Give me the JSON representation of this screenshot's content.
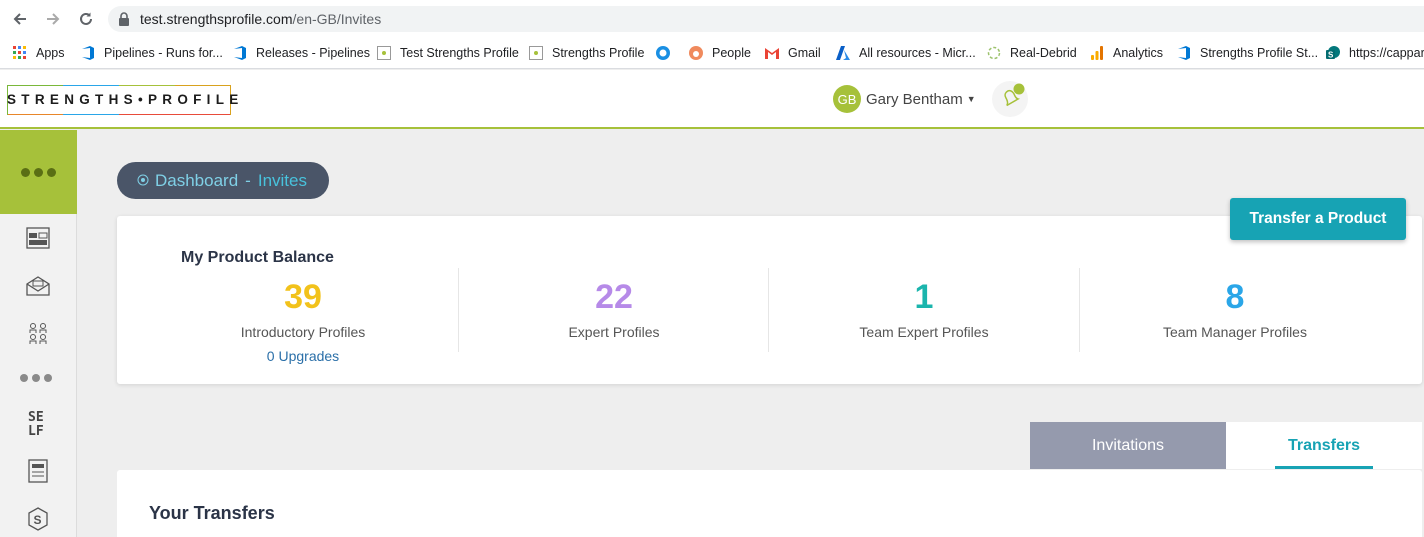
{
  "browser": {
    "url_host": "test.strengthsprofile.com",
    "url_path": "/en-GB/Invites",
    "bookmarks": [
      {
        "label": "Apps",
        "icon": "apps-grid-icon"
      },
      {
        "label": "Pipelines - Runs for...",
        "icon": "azure-devops-icon"
      },
      {
        "label": "Releases - Pipelines",
        "icon": "azure-devops-icon"
      },
      {
        "label": "Test Strengths Profile",
        "icon": "strengths-profile-icon"
      },
      {
        "label": "Strengths Profile",
        "icon": "strengths-profile-icon"
      },
      {
        "label": "",
        "icon": "circle-logo-icon"
      },
      {
        "label": "People",
        "icon": "hubspot-icon"
      },
      {
        "label": "Gmail",
        "icon": "gmail-icon"
      },
      {
        "label": "All resources - Micr...",
        "icon": "azure-icon"
      },
      {
        "label": "Real-Debrid",
        "icon": "real-debrid-icon"
      },
      {
        "label": "Analytics",
        "icon": "analytics-icon"
      },
      {
        "label": "Strengths Profile St...",
        "icon": "azure-devops-icon"
      },
      {
        "label": "https://cappar",
        "icon": "sharepoint-icon"
      }
    ]
  },
  "header": {
    "logo_text": "STRENGTHS•PROFILE",
    "user_initials": "GB",
    "user_name": "Gary Bentham",
    "accent_color": "#a6c13a"
  },
  "breadcrumb": {
    "root": "Dashboard",
    "separator": "-",
    "current": "Invites"
  },
  "actions": {
    "transfer_label": "Transfer a Product"
  },
  "balance": {
    "title": "My Product Balance",
    "stats": [
      {
        "value": "39",
        "label": "Introductory Profiles",
        "sub": "0 Upgrades",
        "color": "#f2c21b"
      },
      {
        "value": "22",
        "label": "Expert Profiles",
        "color": "#b68ae8"
      },
      {
        "value": "1",
        "label": "Team Expert Profiles",
        "color": "#1bb5ad"
      },
      {
        "value": "8",
        "label": "Team Manager Profiles",
        "color": "#2aa6e8"
      }
    ]
  },
  "tabs": {
    "invitations": "Invitations",
    "transfers": "Transfers",
    "active": "transfers"
  },
  "transfers": {
    "title": "Your Transfers"
  }
}
